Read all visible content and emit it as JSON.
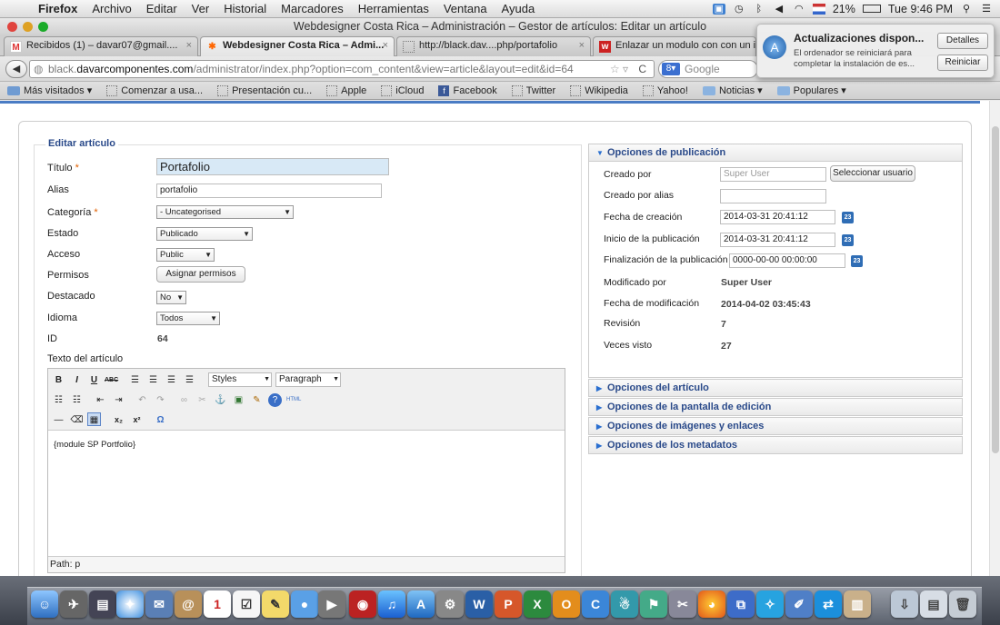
{
  "menubar": {
    "app": "Firefox",
    "items": [
      "Archivo",
      "Editar",
      "Ver",
      "Historial",
      "Marcadores",
      "Herramientas",
      "Ventana",
      "Ayuda"
    ],
    "battery": "21%",
    "clock": "Tue 9:46 PM"
  },
  "window": {
    "title": "Webdesigner Costa Rica – Administración – Gestor de artículos: Editar un artículo"
  },
  "tabs": [
    {
      "label": "Recibidos (1) – davar07@gmail....",
      "icon": "gmail-icon"
    },
    {
      "label": "Webdesigner Costa Rica – Admi...",
      "icon": "joomla-icon"
    },
    {
      "label": "http://black.dav....php/portafolio",
      "icon": "page-icon"
    },
    {
      "label": "Enlazar un modulo con con un i",
      "icon": "w-icon"
    }
  ],
  "nav": {
    "url_prefix": "black.",
    "url_domain": "davarcomponentes.com",
    "url_path": "/administrator/index.php?option=com_content&view=article&layout=edit&id=64",
    "search_placeholder": "Google"
  },
  "bookmarks": [
    "Más visitados ▾",
    "Comenzar a usa...",
    "Presentación cu...",
    "Apple",
    "iCloud",
    "Facebook",
    "Twitter",
    "Wikipedia",
    "Yahoo!",
    "Noticias ▾",
    "Populares ▾"
  ],
  "notification": {
    "title": "Actualizaciones dispon...",
    "text": "El ordenador se reiniciará para completar la instalación de es...",
    "btn_details": "Detalles",
    "btn_restart": "Reiniciar"
  },
  "form": {
    "legend": "Editar artículo",
    "title_label": "Título",
    "title_value": "Portafolio",
    "alias_label": "Alias",
    "alias_value": "portafolio",
    "category_label": "Categoría",
    "category_value": "- Uncategorised",
    "state_label": "Estado",
    "state_value": "Publicado",
    "access_label": "Acceso",
    "access_value": "Public",
    "permissions_label": "Permisos",
    "permissions_button": "Asignar permisos",
    "featured_label": "Destacado",
    "featured_value": "No",
    "language_label": "Idioma",
    "language_value": "Todos",
    "id_label": "ID",
    "id_value": "64",
    "text_label": "Texto del artículo"
  },
  "editor": {
    "styles": "Styles",
    "format": "Paragraph",
    "content": "{module SP Portfolio}",
    "path": "Path: p"
  },
  "publishing": {
    "header": "Opciones de publicación",
    "created_by_label": "Creado por",
    "created_by_value": "Super User",
    "select_user_button": "Seleccionar usuario",
    "created_alias_label": "Creado por alias",
    "created_date_label": "Fecha de creación",
    "created_date_value": "2014-03-31 20:41:12",
    "publish_up_label": "Inicio de la publicación",
    "publish_up_value": "2014-03-31 20:41:12",
    "publish_down_label": "Finalización de la publicación",
    "publish_down_value": "0000-00-00 00:00:00",
    "modified_by_label": "Modificado por",
    "modified_by_value": "Super User",
    "modified_date_label": "Fecha de modificación",
    "modified_date_value": "2014-04-02 03:45:43",
    "revision_label": "Revisión",
    "revision_value": "7",
    "hits_label": "Veces visto",
    "hits_value": "27",
    "calendar_icon_text": "23"
  },
  "accordions": [
    "Opciones del artículo",
    "Opciones de la pantalla de edición",
    "Opciones de imágenes y enlaces",
    "Opciones de los metadatos"
  ]
}
